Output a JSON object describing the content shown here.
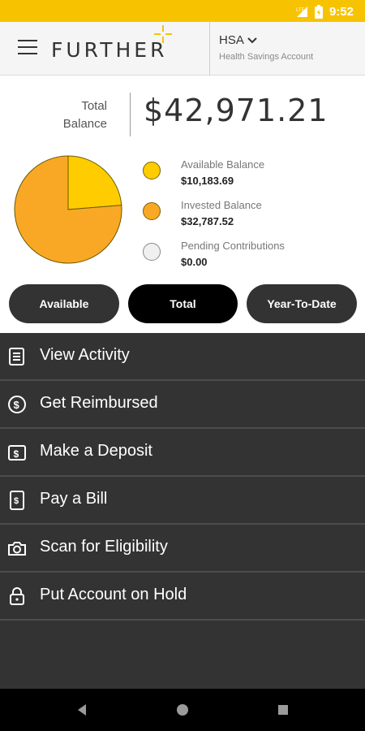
{
  "status_bar": {
    "time": "9:52",
    "background_color": "#f7c300",
    "icons": [
      "signal-lte-icon",
      "battery-icon"
    ]
  },
  "header": {
    "brand": "FURTHER",
    "account_type": "HSA",
    "account_subtitle": "Health Savings Account",
    "icons": [
      "menu-icon",
      "chevron-down-icon"
    ]
  },
  "balance": {
    "label_line1": "Total",
    "label_line2": "Balance",
    "amount": "$42,971.21"
  },
  "chart_data": {
    "type": "pie",
    "title": "",
    "slices": [
      {
        "name": "Available Balance",
        "value": 10183.69,
        "color": "#ffcc00"
      },
      {
        "name": "Invested Balance",
        "value": 32787.52,
        "color": "#f9a825"
      },
      {
        "name": "Pending Contributions",
        "value": 0.0,
        "color": "#f0f0f0"
      }
    ]
  },
  "legend": [
    {
      "label": "Available Balance",
      "value": "$10,183.69",
      "color": "#ffcc00"
    },
    {
      "label": "Invested Balance",
      "value": "$32,787.52",
      "color": "#f9a825"
    },
    {
      "label": "Pending Contributions",
      "value": "$0.00",
      "color": "#f0f0f0"
    }
  ],
  "tabs": [
    {
      "label": "Available",
      "active": false
    },
    {
      "label": "Total",
      "active": true
    },
    {
      "label": "Year-To-Date",
      "active": false
    }
  ],
  "menu": [
    {
      "label": "View Activity",
      "icon": "activity-ledger-icon"
    },
    {
      "label": "Get Reimbursed",
      "icon": "dollar-reimburse-icon"
    },
    {
      "label": "Make a Deposit",
      "icon": "deposit-icon"
    },
    {
      "label": "Pay a Bill",
      "icon": "bill-icon"
    },
    {
      "label": "Scan for Eligibility",
      "icon": "camera-icon"
    },
    {
      "label": "Put Account on Hold",
      "icon": "lock-icon"
    }
  ],
  "nav_bar": {
    "icons": [
      "back-icon",
      "home-icon",
      "recents-icon"
    ]
  }
}
